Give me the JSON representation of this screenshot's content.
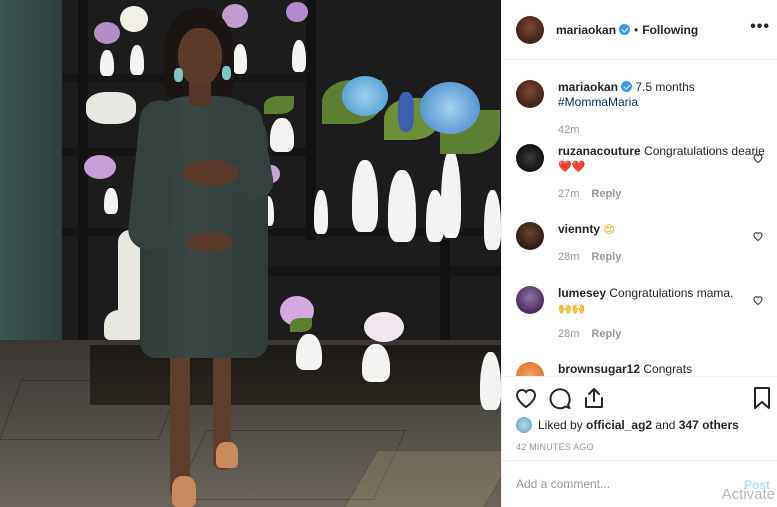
{
  "post": {
    "author": "mariaokan",
    "follow_status": "Following",
    "separator": "•",
    "more_label": "•••",
    "caption_text": "7.5 months",
    "caption_tag": "#MommaMaria",
    "caption_age": "42m"
  },
  "comments": [
    {
      "user": "ruzanacouture",
      "text": "Congratulations dearie",
      "emoji": "❤️❤️",
      "age": "27m",
      "reply": "Reply"
    },
    {
      "user": "viennty",
      "text": "",
      "emoji": "😍",
      "age": "28m",
      "reply": "Reply"
    },
    {
      "user": "lumesey",
      "text": "Congratulations mama.",
      "emoji": "🙌🙌",
      "age": "28m",
      "reply": "Reply"
    },
    {
      "user": "brownsugar12",
      "text": "Congrats"
    }
  ],
  "likes": {
    "prefix": "Liked by",
    "user": "official_ag2",
    "joiner": "and",
    "others": "347 others"
  },
  "timestamp": "42 MINUTES AGO",
  "add_comment": {
    "placeholder": "Add a comment...",
    "post_label": "Post"
  },
  "watermark": "Activate",
  "icons": {
    "like": "heart-icon",
    "comment": "comment-icon",
    "share": "share-icon",
    "save": "bookmark-icon",
    "verified": "verified-badge-icon"
  },
  "colors": {
    "verified": "#3897f0",
    "muted": "#999999",
    "post_disabled": "#b2dffc"
  }
}
